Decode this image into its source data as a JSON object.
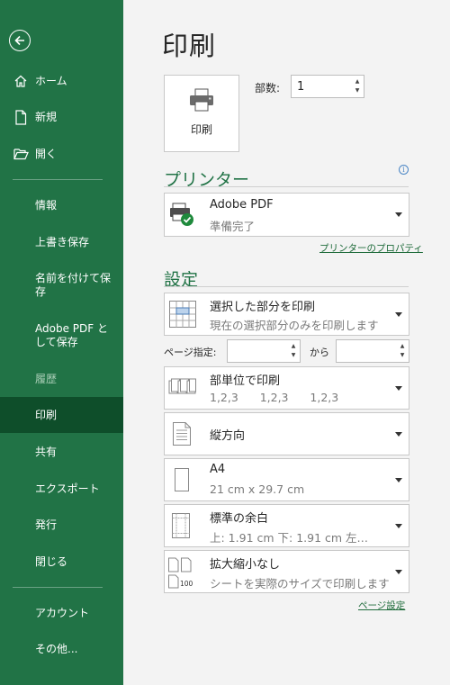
{
  "sidebar": {
    "items": [
      {
        "label": "ホーム",
        "icon": "home-icon"
      },
      {
        "label": "新規",
        "icon": "new-doc-icon"
      },
      {
        "label": "開く",
        "icon": "open-folder-icon"
      },
      {
        "label": "情報"
      },
      {
        "label": "上書き保存"
      },
      {
        "label": "名前を付けて保存"
      },
      {
        "label": "Adobe PDF として保存"
      },
      {
        "label": "履歴"
      },
      {
        "label": "印刷"
      },
      {
        "label": "共有"
      },
      {
        "label": "エクスポート"
      },
      {
        "label": "発行"
      },
      {
        "label": "閉じる"
      },
      {
        "label": "アカウント"
      },
      {
        "label": "その他..."
      }
    ],
    "active_item": "印刷",
    "bg_color": "#217346",
    "active_color": "#0e4e2a"
  },
  "main": {
    "title": "印刷",
    "print_button_label": "印刷",
    "copies_label": "部数:",
    "copies_value": "1",
    "printer_heading": "プリンター",
    "printer": {
      "name": "Adobe PDF",
      "status": "準備完了"
    },
    "printer_properties_link": "プリンターのプロパティ",
    "settings_heading": "設定",
    "settings": [
      {
        "title": "選択した部分を印刷",
        "subtitle": "現在の選択部分のみを印刷します",
        "icon": "print-selection-icon"
      },
      {
        "title": "部単位で印刷",
        "subtitle": "1,2,3    1,2,3    1,2,3",
        "icon": "collated-icon"
      },
      {
        "title": "縦方向",
        "subtitle": "",
        "icon": "portrait-icon"
      },
      {
        "title": "A4",
        "subtitle": "21 cm x 29.7 cm",
        "icon": "paper-size-icon"
      },
      {
        "title": "標準の余白",
        "subtitle": "上: 1.91 cm 下: 1.91 cm 左…",
        "icon": "margins-icon"
      },
      {
        "title": "拡大縮小なし",
        "subtitle": "シートを実際のサイズで印刷します",
        "icon": "no-scaling-icon"
      }
    ],
    "pages_label": "ページ指定:",
    "pages_to_label": "から",
    "pages_from_value": "",
    "pages_to_value": "",
    "page_setup_link": "ページ設定",
    "accent_color": "#217346"
  }
}
